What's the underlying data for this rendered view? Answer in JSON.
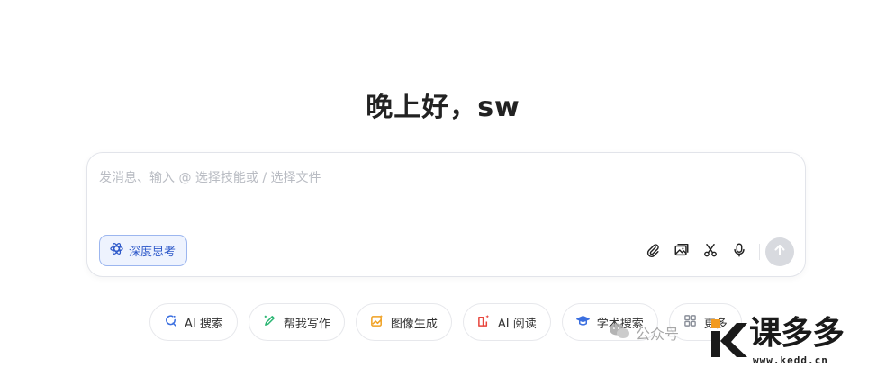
{
  "greeting": "晚上好，sw",
  "composer": {
    "placeholder": "发消息、输入 @ 选择技能或 / 选择文件",
    "deep_think_label": "深度思考",
    "tools": [
      "paperclip-icon",
      "image-upload-icon",
      "scissors-icon",
      "microphone-icon"
    ],
    "send_icon": "arrow-up-icon"
  },
  "chips": [
    {
      "label": "AI 搜索",
      "icon": "search-refresh-icon",
      "color": "#3b6fe0"
    },
    {
      "label": "帮我写作",
      "icon": "pen-icon",
      "color": "#2bb673"
    },
    {
      "label": "图像生成",
      "icon": "image-spark-icon",
      "color": "#f0a020"
    },
    {
      "label": "AI 阅读",
      "icon": "book-spark-icon",
      "color": "#e8453c"
    },
    {
      "label": "学术搜索",
      "icon": "graduation-cap-icon",
      "color": "#3b6fe0"
    },
    {
      "label": "更多",
      "icon": "grid-icon",
      "color": "#8a8f99"
    }
  ],
  "watermarks": {
    "wechat_text": "公众号",
    "logo_name": "课多多",
    "logo_url": "www.kedd.cn"
  },
  "colors": {
    "accent": "#2d58c9",
    "accent_bg": "#eef3fe",
    "send_disabled": "#d8dadf"
  }
}
